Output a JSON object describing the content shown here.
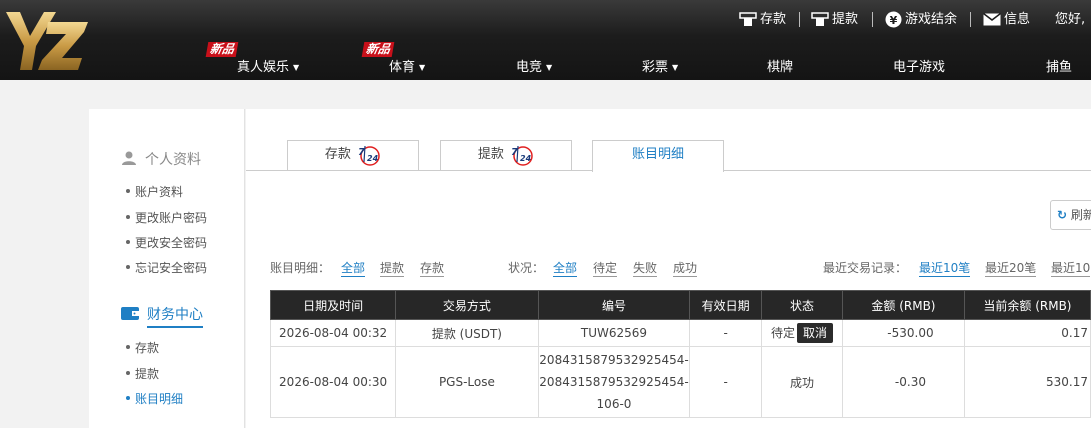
{
  "header": {
    "logo_text": "YZ",
    "quick": {
      "deposit": "存款",
      "withdraw": "提款",
      "settle": "游戏结余",
      "messages": "信息",
      "greeting": "您好,"
    },
    "nav": [
      {
        "label": "真人娱乐",
        "badge": "新品"
      },
      {
        "label": "体育",
        "badge": "新品"
      },
      {
        "label": "电竞"
      },
      {
        "label": "彩票"
      },
      {
        "label": "棋牌"
      },
      {
        "label": "电子游戏"
      },
      {
        "label": "捕鱼"
      }
    ]
  },
  "sidebar": {
    "profile": {
      "title": "个人资料",
      "items": [
        "账户资料",
        "更改账户密码",
        "更改安全密码",
        "忘记安全密码"
      ]
    },
    "finance": {
      "title": "财务中心",
      "items": [
        "存款",
        "提款",
        "账目明细"
      ]
    }
  },
  "tabs": {
    "deposit": "存款",
    "withdraw": "提款",
    "statement": "账目明细",
    "badge_724": "7/24"
  },
  "refresh_label": "刷新",
  "filters": {
    "type_label": "账目明细：",
    "type_options": [
      "全部",
      "提款",
      "存款"
    ],
    "status_label": "状况：",
    "status_options": [
      "全部",
      "待定",
      "失败",
      "成功"
    ],
    "recent_label": "最近交易记录：",
    "recent_options": [
      "最近10笔",
      "最近20笔",
      "最近10"
    ]
  },
  "table": {
    "columns": [
      "日期及时间",
      "交易方式",
      "编号",
      "有效日期",
      "状态",
      "金额 (RMB)",
      "当前余额 (RMB)"
    ],
    "rows": [
      {
        "datetime": "2026-08-04 00:32",
        "method": "提款 (USDT)",
        "ref": [
          "TUW62569"
        ],
        "valid": "-",
        "status": "待定",
        "action": "取消",
        "amount": "-530.00",
        "balance": "0.17"
      },
      {
        "datetime": "2026-08-04 00:30",
        "method": "PGS-Lose",
        "ref": [
          "2084315879532925454-",
          "2084315879532925454-",
          "106-0"
        ],
        "valid": "-",
        "status": "成功",
        "amount": "-0.30",
        "balance": "530.17"
      }
    ]
  },
  "colors": {
    "accent": "#1f7fc4",
    "header_bg": "#1c1c1c",
    "badge_red": "#c8101a",
    "gold": "#d8b15c"
  }
}
